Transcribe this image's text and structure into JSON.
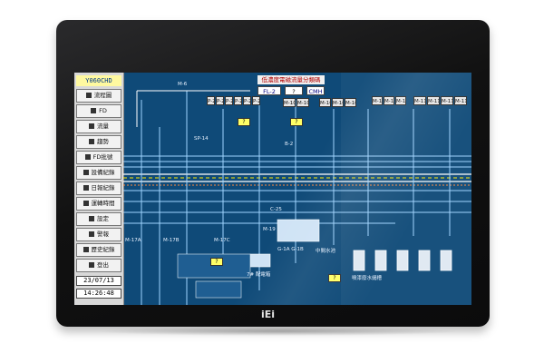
{
  "brand": {
    "logo_text": "iEi"
  },
  "sidebar": {
    "header": "Y060CHD",
    "buttons": [
      {
        "label": "流程圖",
        "icon": "flow-chart-icon"
      },
      {
        "label": "FD",
        "icon": "fd-icon"
      },
      {
        "label": "流量",
        "icon": "flow-icon"
      },
      {
        "label": "趨勢",
        "icon": "trend-icon"
      },
      {
        "label": "FD批號",
        "icon": "batch-icon"
      },
      {
        "label": "設備紀錄",
        "icon": "equipment-log-icon"
      },
      {
        "label": "日報紀錄",
        "icon": "daily-report-icon"
      },
      {
        "label": "運轉時間",
        "icon": "runtime-icon"
      },
      {
        "label": "設定",
        "icon": "settings-icon"
      },
      {
        "label": "警報",
        "icon": "alarm-icon"
      },
      {
        "label": "歷史紀錄",
        "icon": "history-icon"
      },
      {
        "label": "登出",
        "icon": "logout-icon"
      }
    ],
    "date": "23/07/13",
    "time": "14:26:48"
  },
  "display": {
    "title": "低濃度電磁流量分類碼",
    "fl_label": "FL-2",
    "fl_value": "?",
    "fl_unit": "CMH",
    "units_top_left": [
      "P-2A",
      "P-2B",
      "P-2C",
      "P-2D",
      "P-2E",
      "P-2F"
    ],
    "units_top_mid": [
      "M-10A",
      "M-10B"
    ],
    "units_top_mid2": [
      "M-10C",
      "M-10D",
      "M-10E"
    ],
    "units_top_right": [
      "M-11A",
      "M-11B",
      "M-11C"
    ],
    "units_top_right2": [
      "M-11D",
      "M-11E",
      "M-11F",
      "M-11G"
    ],
    "question_marks": [
      "?",
      "?",
      "?",
      "?"
    ],
    "labels": {
      "sp14": "SP-14",
      "b2": "B-2",
      "m6": "M-6",
      "m17a": "M-17A",
      "m17b": "M-17B",
      "m17c": "M-17C",
      "c25": "C-25",
      "m19": "M-19",
      "g1a": "G-1A G-1B",
      "bottom1": "7# 配電箱",
      "bottom2": "中間水池",
      "bottom3": "噴漆廢水儲槽"
    }
  }
}
